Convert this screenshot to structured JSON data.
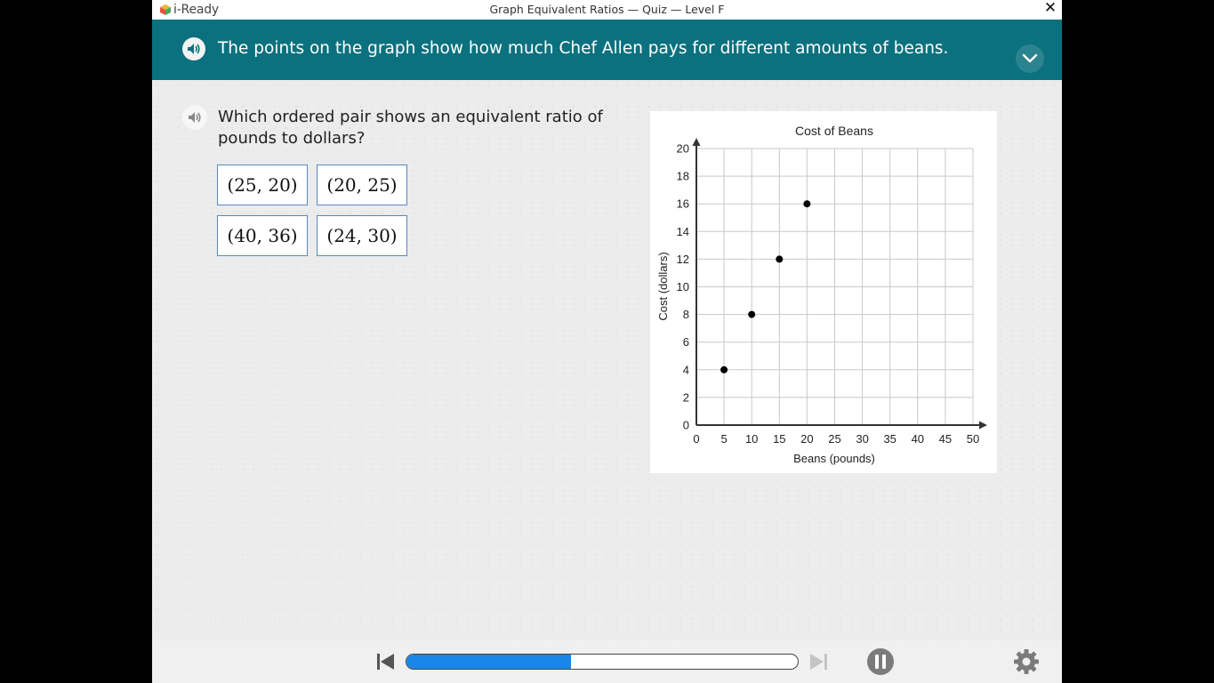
{
  "app": {
    "logo_text": "i-Ready",
    "window_title": "Graph Equivalent Ratios — Quiz — Level F",
    "close_glyph": "✕"
  },
  "banner": {
    "text": "The points on the graph show how much Chef Allen pays for different amounts of beans.",
    "background": "#0b717e"
  },
  "question": {
    "text": "Which ordered pair shows an equivalent ratio of pounds to dollars?"
  },
  "choices": [
    "(25, 20)",
    "(20, 25)",
    "(40, 36)",
    "(24, 30)"
  ],
  "chart_data": {
    "type": "scatter",
    "title": "Cost of Beans",
    "xlabel": "Beans (pounds)",
    "ylabel": "Cost (dollars)",
    "xlim": [
      0,
      50
    ],
    "ylim": [
      0,
      20
    ],
    "xticks": [
      0,
      5,
      10,
      15,
      20,
      25,
      30,
      35,
      40,
      45,
      50
    ],
    "yticks": [
      0,
      2,
      4,
      6,
      8,
      10,
      12,
      14,
      16,
      18,
      20
    ],
    "grid": true,
    "points": [
      {
        "x": 5,
        "y": 4
      },
      {
        "x": 10,
        "y": 8
      },
      {
        "x": 15,
        "y": 12
      },
      {
        "x": 20,
        "y": 16
      }
    ]
  },
  "footer": {
    "progress_fraction": 0.42,
    "progress_color": "#1a86e8"
  }
}
